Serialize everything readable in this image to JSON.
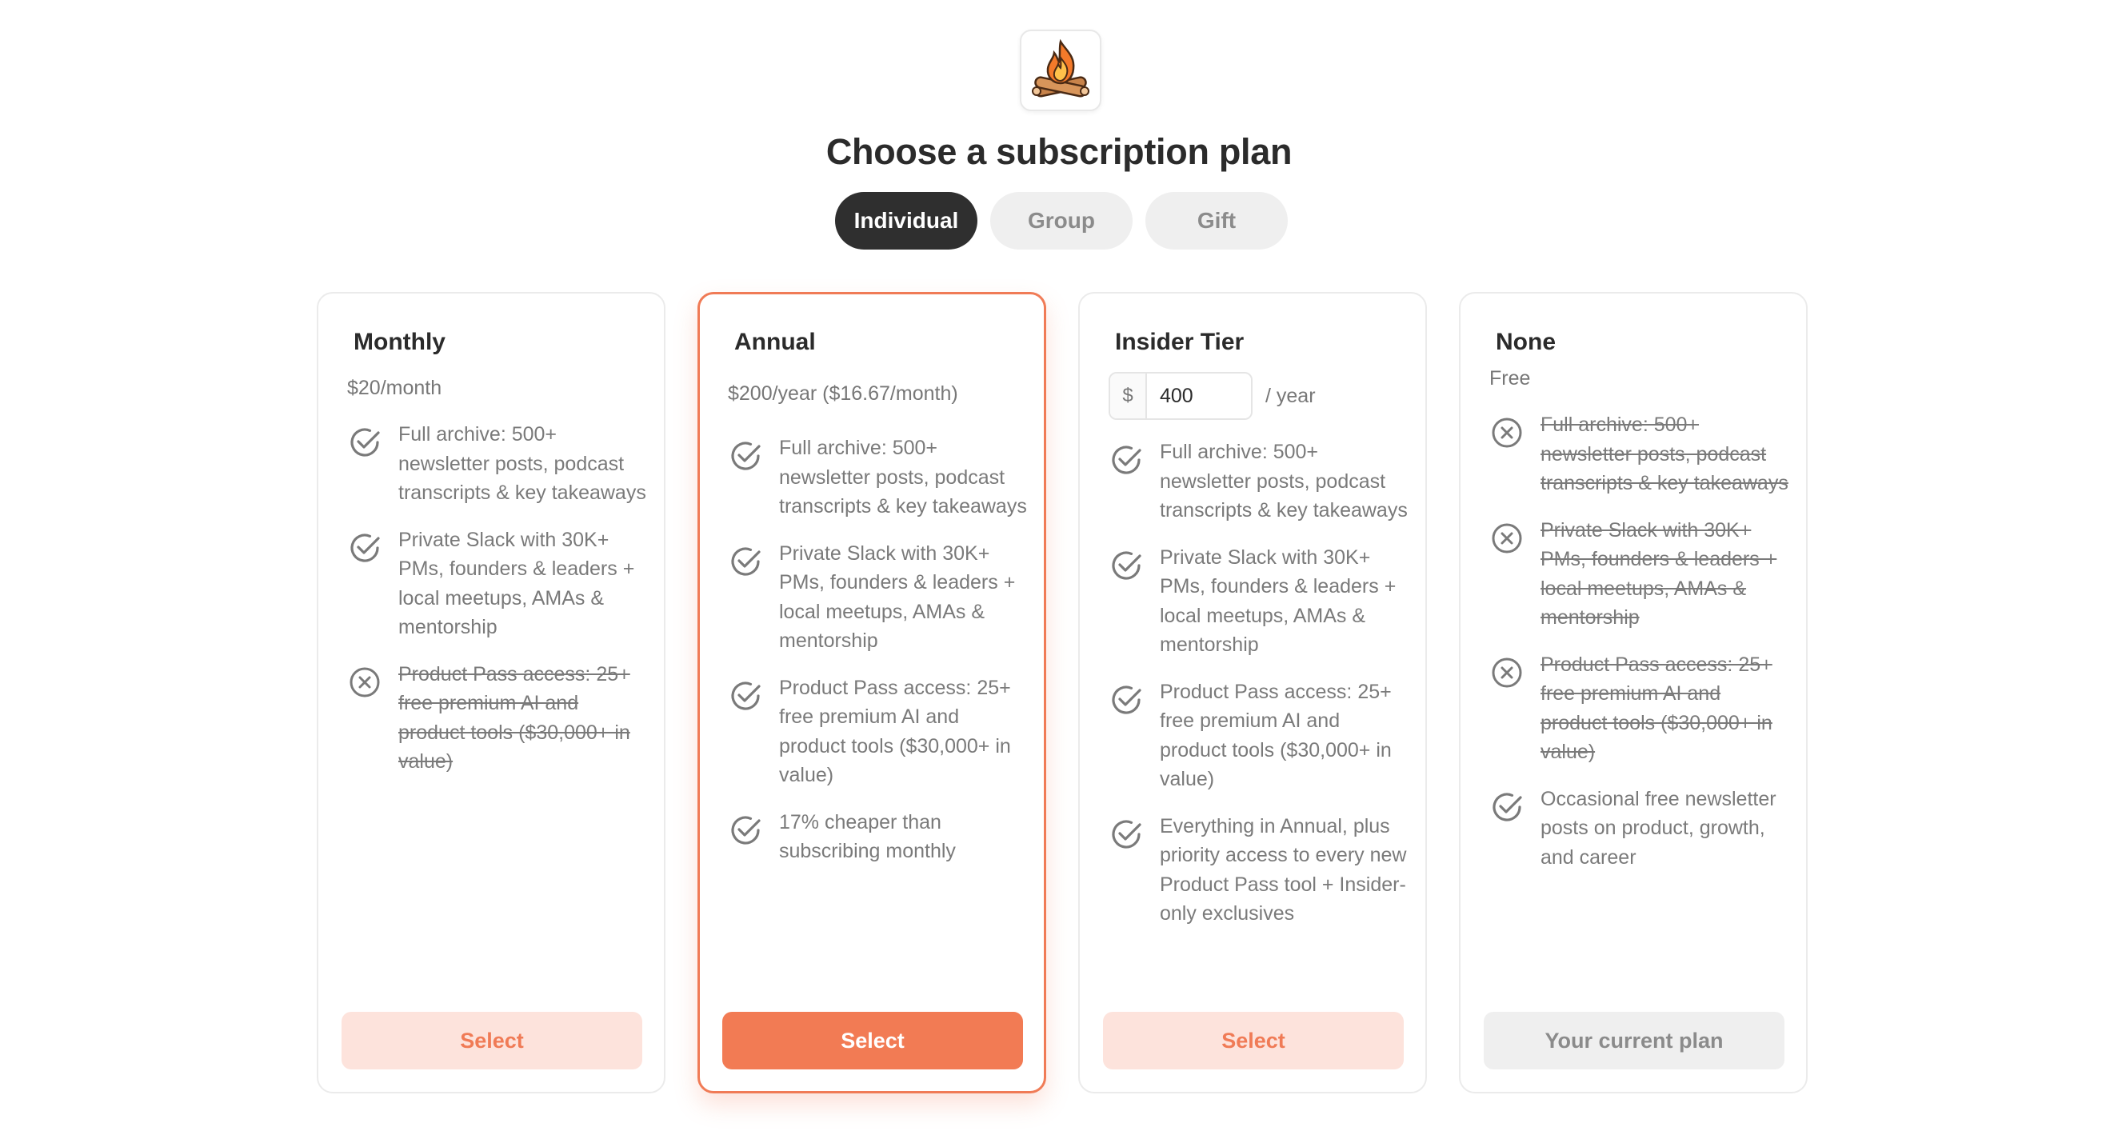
{
  "header": {
    "logo_icon": "campfire-icon",
    "title": "Choose a subscription plan"
  },
  "tabs": [
    {
      "label": "Individual",
      "active": true
    },
    {
      "label": "Group",
      "active": false
    },
    {
      "label": "Gift",
      "active": false
    }
  ],
  "colors": {
    "accent": "#f27b54",
    "accent_light": "#fde3dc",
    "dark": "#2f2f2f",
    "muted": "#7a7a7a"
  },
  "plans": [
    {
      "title": "Monthly",
      "price": "$20/month",
      "features": [
        {
          "text": "Full archive: 500+ newsletter posts, podcast transcripts & key takeaways",
          "included": true
        },
        {
          "text": "Private Slack with 30K+ PMs, founders & leaders + local meetups, AMAs & mentorship",
          "included": true
        },
        {
          "text": "Product Pass access: 25+ free premium AI and product tools ($30,000+ in value)",
          "included": false
        }
      ],
      "button": "Select"
    },
    {
      "title": "Annual",
      "price": "$200/year ($16.67/month)",
      "features": [
        {
          "text": "Full archive: 500+ newsletter posts, podcast transcripts & key takeaways",
          "included": true
        },
        {
          "text": "Private Slack with 30K+ PMs, founders & leaders + local meetups, AMAs & mentorship",
          "included": true
        },
        {
          "text": "Product Pass access: 25+ free premium AI and product tools ($30,000+ in value)",
          "included": true
        },
        {
          "text": "17% cheaper than subscribing monthly",
          "included": true
        }
      ],
      "button": "Select"
    },
    {
      "title": "Insider Tier",
      "currency": "$",
      "amount": "400",
      "period": "/ year",
      "features": [
        {
          "text": "Full archive: 500+ newsletter posts, podcast transcripts & key takeaways",
          "included": true
        },
        {
          "text": "Private Slack with 30K+ PMs, founders & leaders + local meetups, AMAs & mentorship",
          "included": true
        },
        {
          "text": "Product Pass access: 25+ free premium AI and product tools ($30,000+ in value)",
          "included": true
        },
        {
          "text": "Everything in Annual, plus priority access to every new Product Pass tool + Insider-only exclusives",
          "included": true
        }
      ],
      "button": "Select"
    },
    {
      "title": "None",
      "price": "Free",
      "features": [
        {
          "text": "Full archive: 500+ newsletter posts, podcast transcripts & key takeaways",
          "included": false
        },
        {
          "text": "Private Slack with 30K+ PMs, founders & leaders + local meetups, AMAs & mentorship",
          "included": false
        },
        {
          "text": "Product Pass access: 25+ free premium AI and product tools ($30,000+ in value)",
          "included": false
        },
        {
          "text": "Occasional free newsletter posts on product, growth, and career",
          "included": true
        }
      ],
      "button": "Your current plan"
    }
  ]
}
